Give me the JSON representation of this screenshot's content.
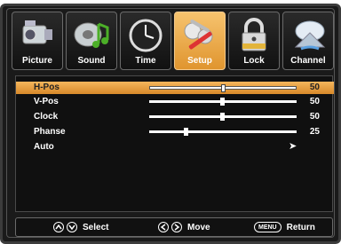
{
  "tabs": [
    {
      "label": "Picture",
      "icon": "camcorder-icon",
      "active": false
    },
    {
      "label": "Sound",
      "icon": "music-note-icon",
      "active": false
    },
    {
      "label": "Time",
      "icon": "clock-icon",
      "active": false
    },
    {
      "label": "Setup",
      "icon": "tools-icon",
      "active": true
    },
    {
      "label": "Lock",
      "icon": "padlock-icon",
      "active": false
    },
    {
      "label": "Channel",
      "icon": "satellite-dish-icon",
      "active": false
    }
  ],
  "settings": [
    {
      "label": "H-Pos",
      "value": "50",
      "level": 0.5,
      "selected": true
    },
    {
      "label": "V-Pos",
      "value": "50",
      "level": 0.5,
      "selected": false
    },
    {
      "label": "Clock",
      "value": "50",
      "level": 0.5,
      "selected": false
    },
    {
      "label": "Phanse",
      "value": "25",
      "level": 0.25,
      "selected": false
    },
    {
      "label": "Auto",
      "arrow": "➤",
      "selected": false
    }
  ],
  "footer": {
    "select_label": "Select",
    "move_label": "Move",
    "menu_key": "MENU",
    "return_label": "Return"
  },
  "colors": {
    "accent": "#e8a040",
    "background": "#101010"
  }
}
